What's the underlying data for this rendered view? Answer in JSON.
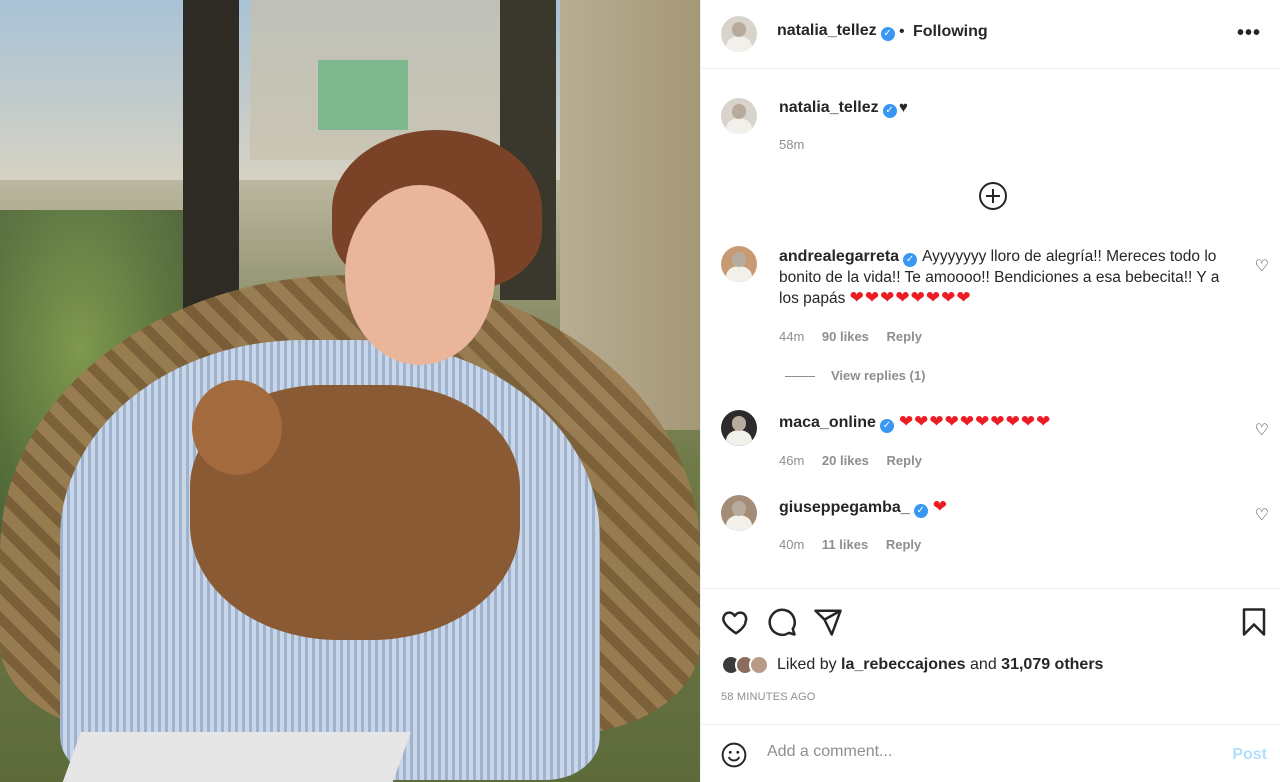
{
  "post": {
    "username": "natalia_tellez",
    "separator": "•",
    "follow_status": "Following",
    "more_label": "•••",
    "caption": {
      "username": "natalia_tellez",
      "text": "♥",
      "time": "58m"
    }
  },
  "comments": [
    {
      "username": "andrealegarreta",
      "verified": true,
      "text": "Ayyyyyyy lloro de alegría!! Mereces todo lo bonito de la vida!! Te amoooo!! Bendiciones a esa bebecita!! Y a los papás",
      "hearts": "❤❤❤❤❤❤❤❤",
      "time": "44m",
      "likes": "90 likes",
      "reply": "Reply",
      "view_replies": "View replies (1)"
    },
    {
      "username": "maca_online",
      "verified": true,
      "text": "",
      "hearts": "❤❤❤❤❤❤❤❤❤❤",
      "time": "46m",
      "likes": "20 likes",
      "reply": "Reply"
    },
    {
      "username": "giuseppegamba_",
      "verified": true,
      "text": "",
      "hearts": "❤",
      "time": "40m",
      "likes": "11 likes",
      "reply": "Reply"
    }
  ],
  "likes": {
    "prefix": "Liked by ",
    "user": "la_rebeccajones",
    "middle": " and ",
    "others": "31,079 others"
  },
  "timestamp": "58 MINUTES AGO",
  "add_comment": {
    "placeholder": "Add a comment...",
    "post_label": "Post"
  },
  "colors": {
    "verified": "#3897f0",
    "heart": "#ed1c24",
    "post_disabled": "#b2dffc",
    "muted": "#8e8e8e"
  }
}
